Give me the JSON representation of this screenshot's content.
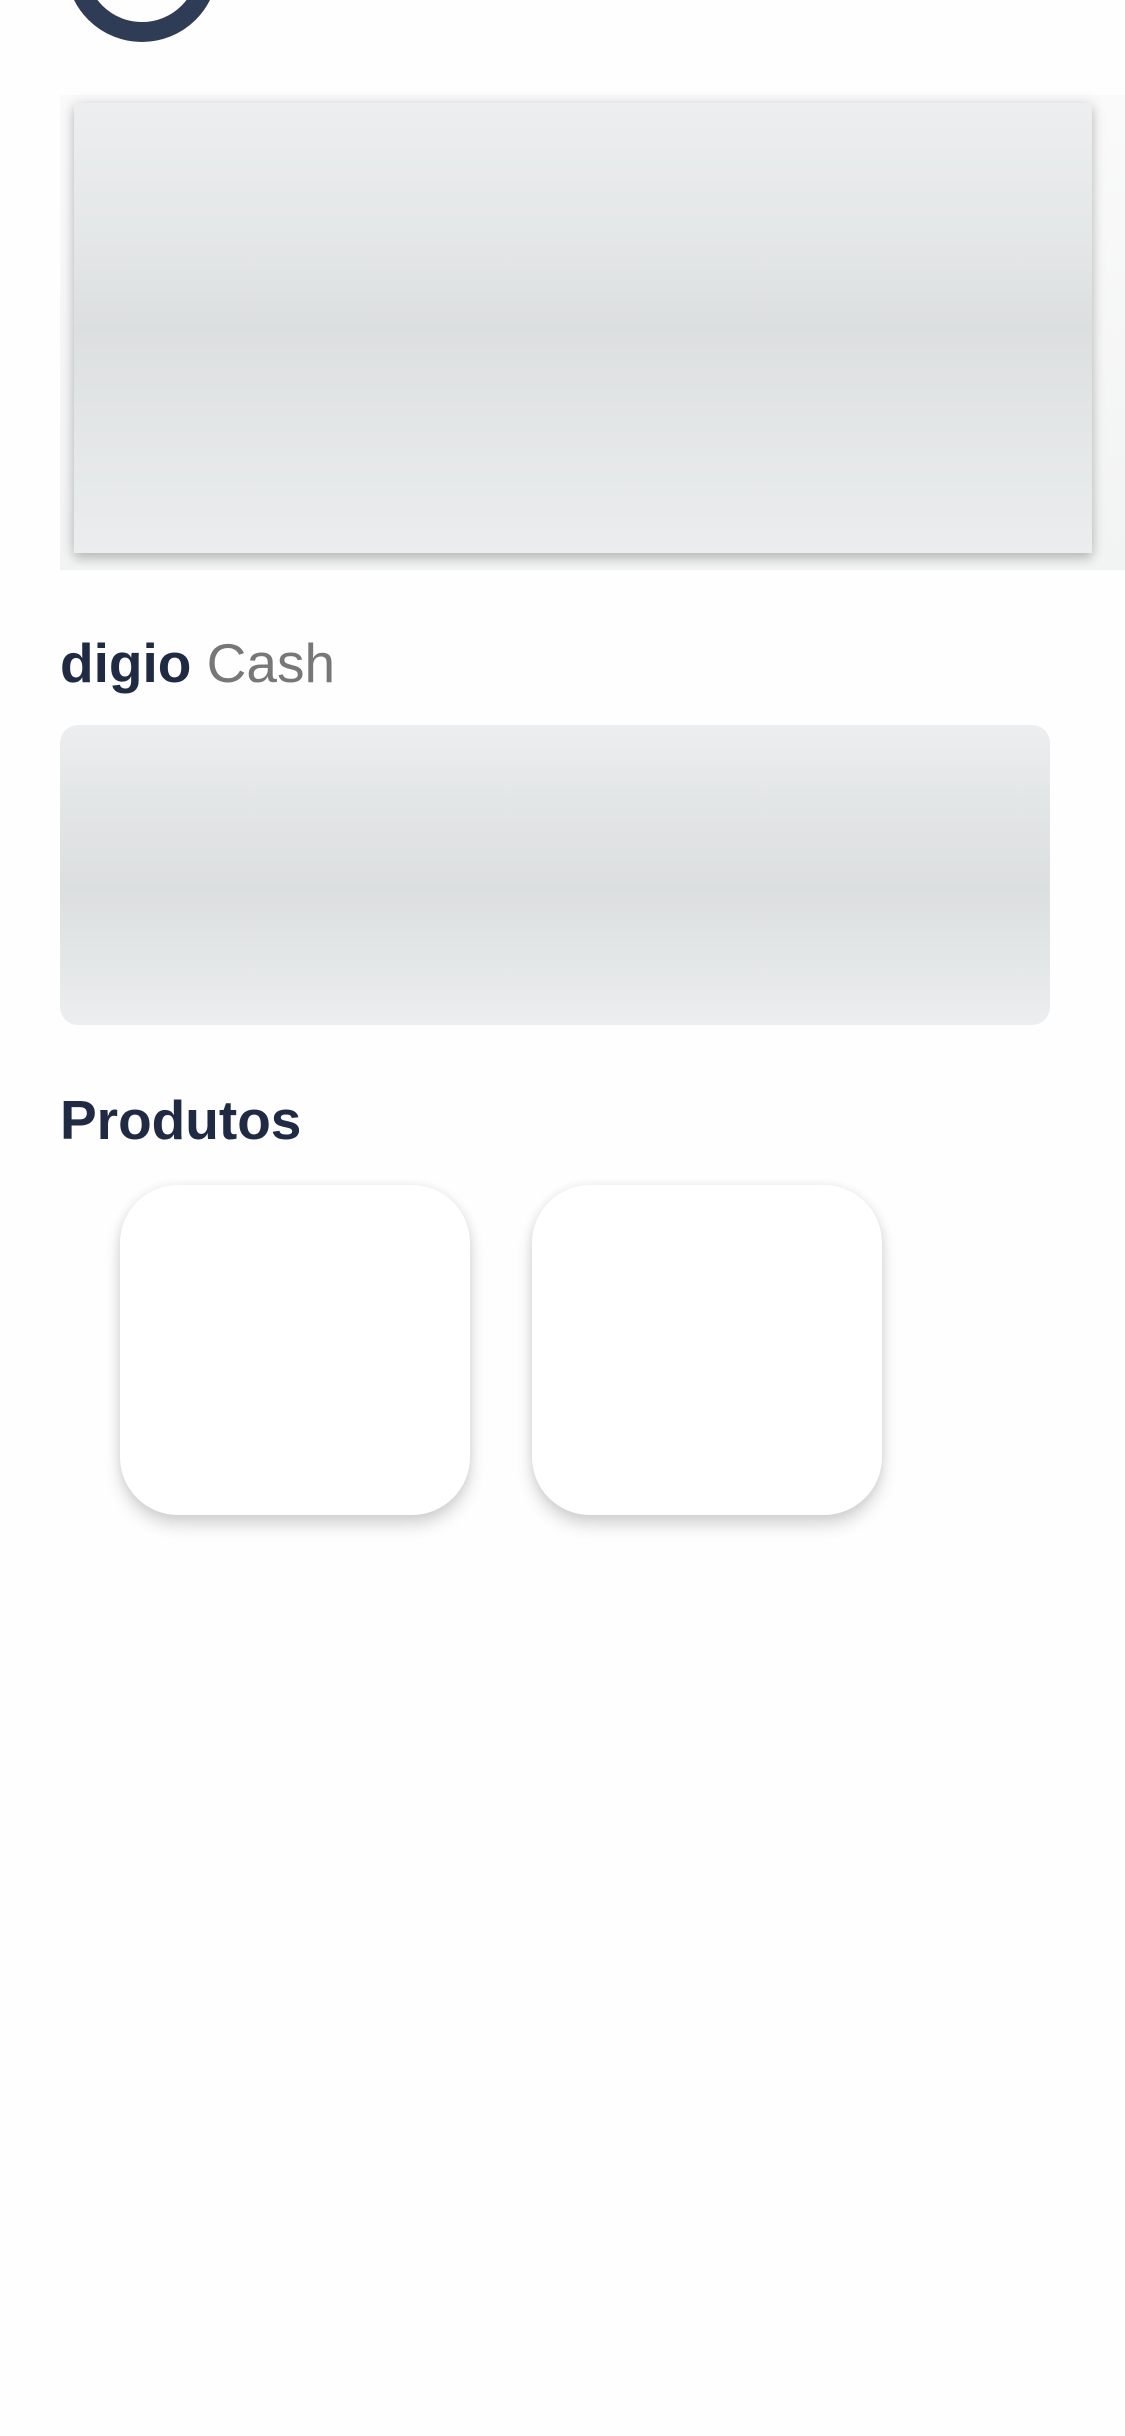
{
  "cash_section": {
    "brand": "digio",
    "word": "Cash"
  },
  "products_section": {
    "title": "Produtos",
    "cards_count": 2
  },
  "colors": {
    "heading": "#1f2b45",
    "muted": "#777777",
    "avatar_ring": "#2e3d55",
    "skeleton": "#dcdfe0",
    "background": "#fefefe"
  }
}
